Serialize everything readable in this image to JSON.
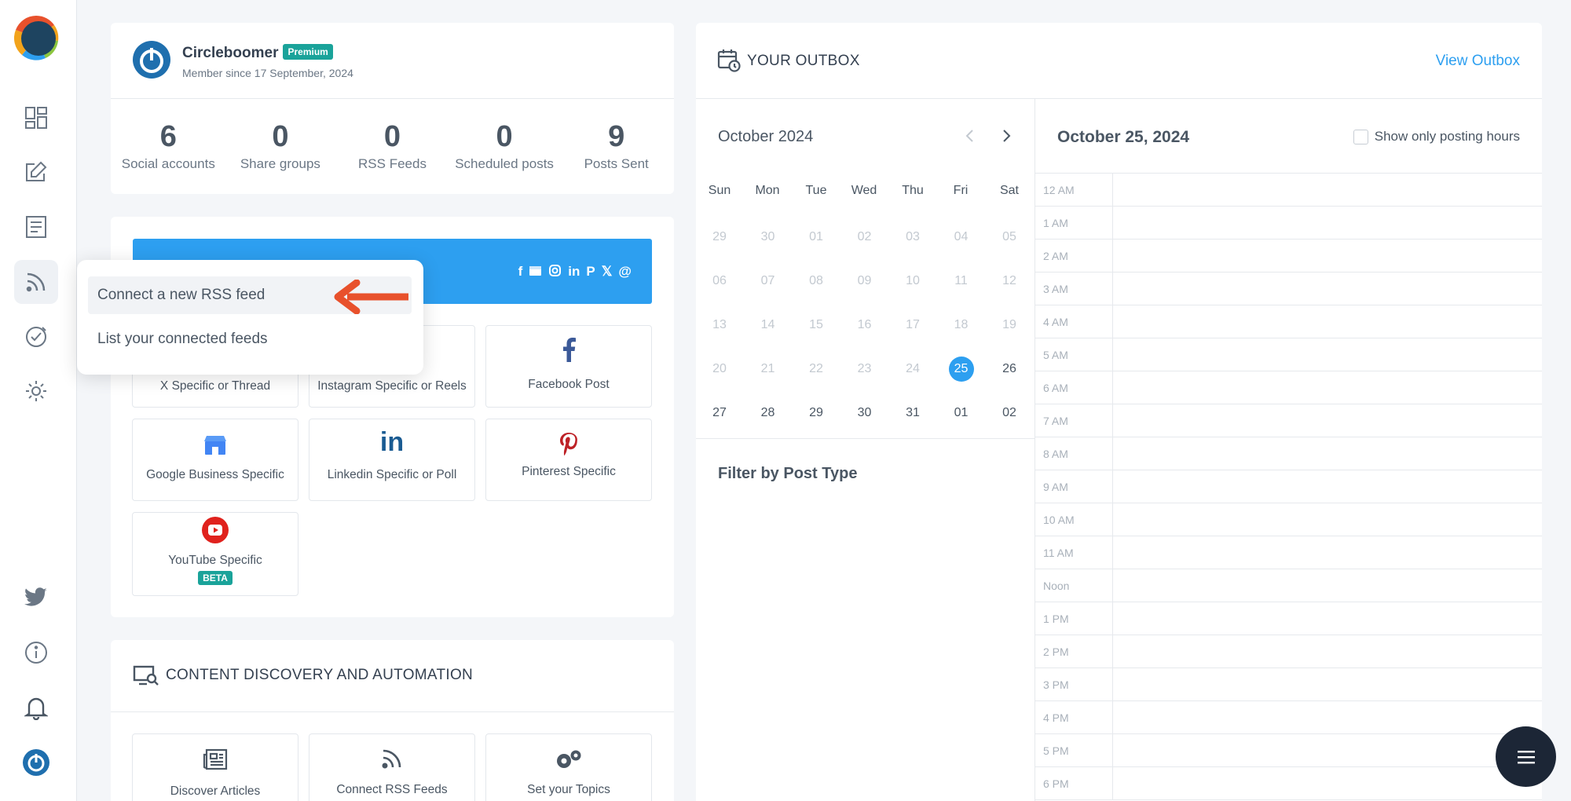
{
  "profile": {
    "name": "Circleboomer",
    "badge": "Premium",
    "member_since": "Member since 17 September, 2024",
    "stats": [
      {
        "value": "6",
        "label": "Social accounts"
      },
      {
        "value": "0",
        "label": "Share groups"
      },
      {
        "value": "0",
        "label": "RSS Feeds"
      },
      {
        "value": "0",
        "label": "Scheduled posts"
      },
      {
        "value": "9",
        "label": "Posts Sent"
      }
    ]
  },
  "banner": {
    "icons": [
      "facebook-icon",
      "google-business-icon",
      "instagram-icon",
      "linkedin-icon",
      "pinterest-icon",
      "x-icon",
      "threads-icon"
    ],
    "x_glyph": "𝕏"
  },
  "rss_menu": {
    "items": [
      "Connect a new RSS feed",
      "List your connected feeds"
    ]
  },
  "post_tiles": {
    "x": "X Specific or Thread",
    "instagram": "Instagram Specific or Reels",
    "facebook": "Facebook Post",
    "google": "Google Business Specific",
    "linkedin": "Linkedin Specific or Poll",
    "linkedin_glyph": "in",
    "pinterest": "Pinterest Specific",
    "youtube": "YouTube Specific",
    "beta": "BETA"
  },
  "discovery": {
    "title": "CONTENT DISCOVERY AND AUTOMATION",
    "tiles": [
      "Discover Articles",
      "Connect RSS Feeds",
      "Set your Topics"
    ]
  },
  "outbox": {
    "title": "YOUR OUTBOX",
    "link": "View Outbox",
    "month": "October 2024",
    "weekdays": [
      "Sun",
      "Mon",
      "Tue",
      "Wed",
      "Thu",
      "Fri",
      "Sat"
    ],
    "weeks": [
      [
        "29",
        "30",
        "01",
        "02",
        "03",
        "04",
        "05"
      ],
      [
        "06",
        "07",
        "08",
        "09",
        "10",
        "11",
        "12"
      ],
      [
        "13",
        "14",
        "15",
        "16",
        "17",
        "18",
        "19"
      ],
      [
        "20",
        "21",
        "22",
        "23",
        "24",
        "25",
        "26"
      ],
      [
        "27",
        "28",
        "29",
        "30",
        "31",
        "01",
        "02"
      ]
    ],
    "selected_day": "25",
    "filter_title": "Filter by Post Type",
    "schedule_date": "October 25, 2024",
    "posting_hours_label": "Show only posting hours",
    "hours": [
      "12 AM",
      "1 AM",
      "2 AM",
      "3 AM",
      "4 AM",
      "5 AM",
      "6 AM",
      "7 AM",
      "8 AM",
      "9 AM",
      "10 AM",
      "11 AM",
      "Noon",
      "1 PM",
      "2 PM",
      "3 PM",
      "4 PM",
      "5 PM",
      "6 PM"
    ]
  },
  "colors": {
    "accent": "#2d9ff0",
    "badge": "#1aa39a",
    "arrow": "#e8512c",
    "fab": "#1c2636"
  }
}
